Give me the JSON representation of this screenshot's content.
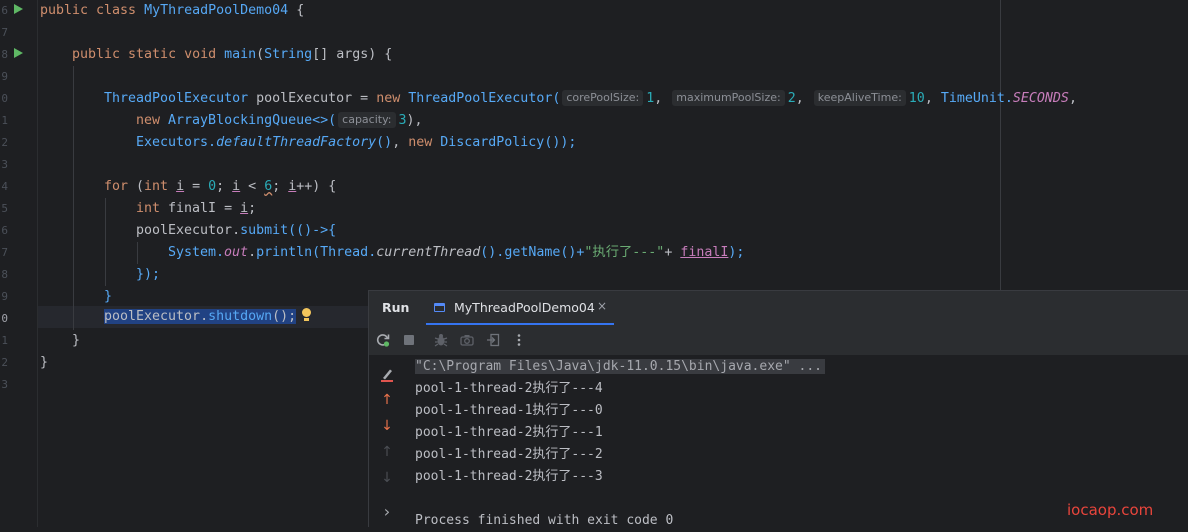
{
  "editor": {
    "line_numbers": [
      "6",
      "7",
      "8",
      "9",
      "0",
      "1",
      "2",
      "3",
      "4",
      "5",
      "6",
      "7",
      "8",
      "9",
      "0",
      "1",
      "2",
      "3"
    ],
    "code": {
      "l1_kw": "public class ",
      "l1_cls": "MyThreadPoolDemo04",
      "l1_rest": " {",
      "l3_kw": "public static void ",
      "l3_fn": "main",
      "l3_rest_a": "(",
      "l3_type": "String",
      "l3_rest_b": "[] args) {",
      "l5_type": "ThreadPoolExecutor",
      "l5_var": " poolExecutor = ",
      "l5_new": "new ",
      "l5_ctor": "ThreadPoolExecutor(",
      "hint_core": "corePoolSize:",
      "l5_v1": "1",
      "comma": ", ",
      "hint_max": "maximumPoolSize:",
      "l5_v2": "2",
      "hint_keep": "keepAliveTime:",
      "l5_v3": "10",
      "l5_timeunit": "TimeUnit.",
      "l5_seconds": "SECONDS",
      "l5_end": ",",
      "l6_new": "new ",
      "l6_cls": "ArrayBlockingQueue<>(",
      "hint_cap": "capacity:",
      "l6_v": "3",
      "l6_end": "),",
      "l7_type": "Executors.",
      "l7_fn": "defaultThreadFactory",
      "l7_paren": "()",
      "l7_mid": ", ",
      "l7_new": "new ",
      "l7_cls": "DiscardPolicy",
      "l7_end": "());",
      "l9_for": "for ",
      "l9_a": "(",
      "l9_int": "int ",
      "l9_i": "i",
      "l9_b": " = ",
      "l9_zero": "0",
      "l9_c": "; ",
      "l9_i2": "i",
      "l9_d": " < ",
      "l9_six": "6",
      "l9_e": "; ",
      "l9_i3": "i",
      "l9_f": "++) {",
      "l10_int": "int ",
      "l10_rest": "finalI = ",
      "l10_i": "i",
      "l10_end": ";",
      "l11_a": "poolExecutor.",
      "l11_fn": "submit",
      "l11_b": "(()->{",
      "l12_type": "System.",
      "l12_out": "out",
      "l12_dot": ".",
      "l12_fn": "println",
      "l12_p": "(",
      "l12_thread": "Thread.",
      "l12_cur": "currentThread",
      "l12_p2": "().",
      "l12_getname": "getName",
      "l12_p3": "()+",
      "l12_str": "\"执行了---\"",
      "l12_plus": "+ ",
      "l12_final": "finalI",
      "l12_end": ");",
      "l13": "});",
      "l14": "}",
      "l15_sel_a": "poolExecutor.",
      "l15_sel_fn": "shutdown",
      "l15_sel_b": "();",
      "l16": "}",
      "l17": "}"
    }
  },
  "run_panel": {
    "title": "Run",
    "tab_label": "MyThreadPoolDemo04",
    "tab_close": "×",
    "console": {
      "command": "\"C:\\Program Files\\Java\\jdk-11.0.15\\bin\\java.exe\" ...",
      "lines": [
        "pool-1-thread-2执行了---4",
        "pool-1-thread-1执行了---0",
        "pool-1-thread-2执行了---1",
        "pool-1-thread-2执行了---2",
        "pool-1-thread-2执行了---3"
      ],
      "exit": "Process finished with exit code 0"
    },
    "side_glyphs": {
      "up": "↑",
      "down": "↓",
      "expand": "›"
    }
  },
  "watermark": "iocaop.com",
  "colors": {
    "background": "#1e1f22",
    "keyword": "#cf8e6d",
    "accent_tab": "#3574f0",
    "run_green": "#5fb865"
  }
}
